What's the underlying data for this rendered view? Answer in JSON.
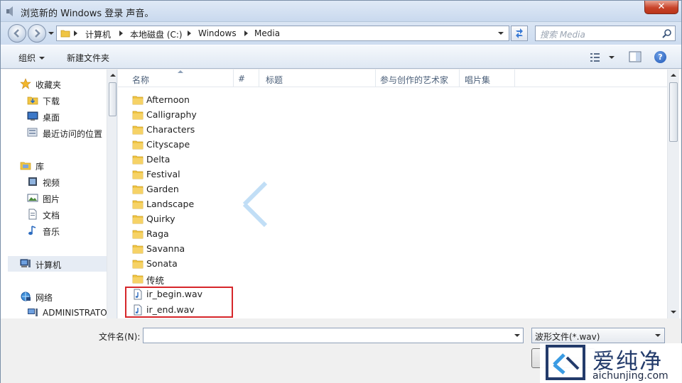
{
  "window": {
    "title": "浏览新的 Windows 登录 声音。",
    "close_label": "✕"
  },
  "address": {
    "crumbs": [
      "计算机",
      "本地磁盘 (C:)",
      "Windows",
      "Media"
    ],
    "search_placeholder": "搜索 Media"
  },
  "toolbar": {
    "organize_label": "组织",
    "new_folder_label": "新建文件夹",
    "help_label": "?"
  },
  "nav": {
    "favorites": "收藏夹",
    "downloads": "下载",
    "desktop": "桌面",
    "recent": "最近访问的位置",
    "libraries": "库",
    "videos": "视频",
    "pictures": "图片",
    "documents": "文档",
    "music": "音乐",
    "computer": "计算机",
    "network": "网络",
    "administrator": "ADMINISTRATO"
  },
  "columns": [
    "名称",
    "#",
    "标题",
    "参与创作的艺术家",
    "唱片集"
  ],
  "folders": [
    "Afternoon",
    "Calligraphy",
    "Characters",
    "Cityscape",
    "Delta",
    "Festival",
    "Garden",
    "Landscape",
    "Quirky",
    "Raga",
    "Savanna",
    "Sonata",
    "传统"
  ],
  "files": [
    "ir_begin.wav",
    "ir_end.wav"
  ],
  "bottom": {
    "filename_label": "文件名(N):",
    "filename_value": "",
    "filetype_value": "波形文件(*.wav)"
  },
  "watermark": {
    "brand_cn": "爱纯净",
    "brand_en": "aichunjing.com"
  },
  "colors": {
    "highlight_border": "#d6262a",
    "folder_yellow": "#f0c544",
    "titlebar": "#dfe9f6",
    "brand_blue": "#233b6b"
  }
}
